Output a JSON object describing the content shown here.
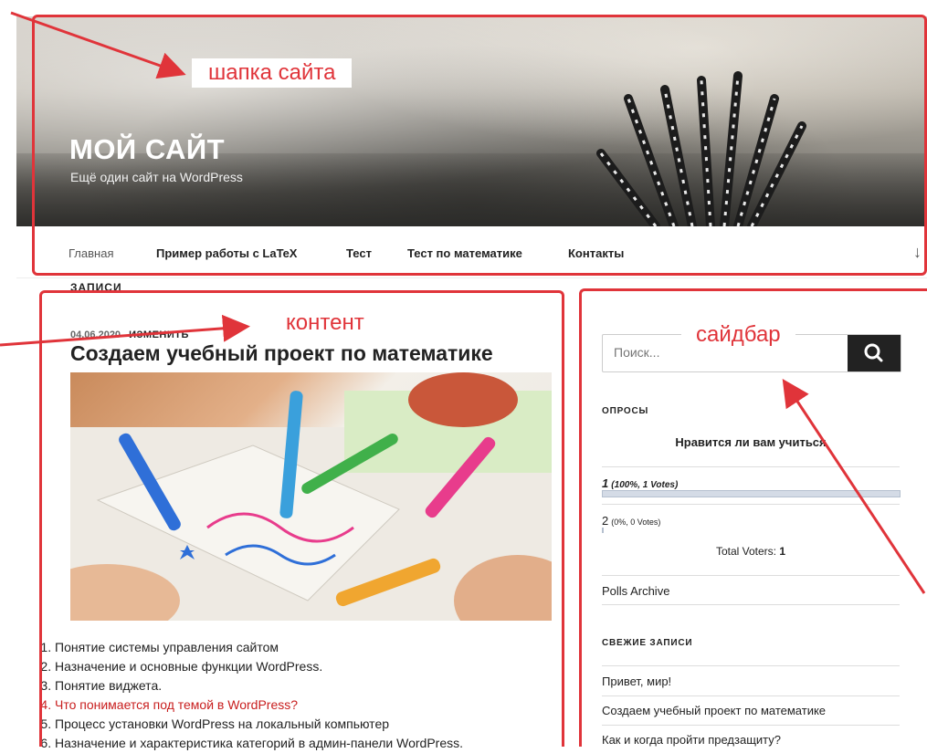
{
  "header": {
    "site_title": "МОЙ САЙТ",
    "site_description": "Ещё один сайт на WordPress"
  },
  "nav": {
    "items": [
      {
        "label": "Главная"
      },
      {
        "label": "Пример работы с LaTeX"
      },
      {
        "label": "Тест"
      },
      {
        "label": "Тест по математике"
      },
      {
        "label": "Контакты"
      }
    ],
    "scroll_icon": "↓"
  },
  "content": {
    "section_label": "ЗАПИСИ",
    "post": {
      "date": "04.06.2020",
      "edit_label": "ИЗМЕНИТЬ",
      "title": "Создаем учебный проект по математике",
      "list": [
        {
          "text": "Понятие системы управления сайтом"
        },
        {
          "text": "Назначение и основные функции WordPress."
        },
        {
          "text": "Понятие виджета."
        },
        {
          "text": "Что понимается под темой в WordPress?"
        },
        {
          "text": "Процесс установки WordPress на локальный компьютер"
        },
        {
          "text": "Назначение и характеристика категорий в админ-панели WordPress."
        }
      ]
    }
  },
  "sidebar": {
    "search_placeholder": "Поиск...",
    "polls": {
      "title": "ОПРОСЫ",
      "question": "Нравится ли вам учиться",
      "answers": [
        {
          "label": "1",
          "detail": "(100%, 1 Votes)",
          "fraction": 1.0
        },
        {
          "label": "2",
          "detail": "(0%, 0 Votes)",
          "fraction": 0.0
        }
      ],
      "total_label": "Total Voters:",
      "total_value": "1",
      "archive_link": "Polls Archive"
    },
    "recent": {
      "title": "СВЕЖИЕ ЗАПИСИ",
      "items": [
        {
          "text": "Привет, мир!"
        },
        {
          "text": "Создаем учебный проект по математике"
        },
        {
          "text": "Как и когда пройти предзащиту?"
        }
      ]
    }
  },
  "annotations": {
    "header_label": "шапка сайта",
    "content_label": "контент",
    "sidebar_label": "сайдбар",
    "color": "#e0343a"
  },
  "icons": {
    "search": "search-icon",
    "scroll": "arrow-down-icon"
  }
}
